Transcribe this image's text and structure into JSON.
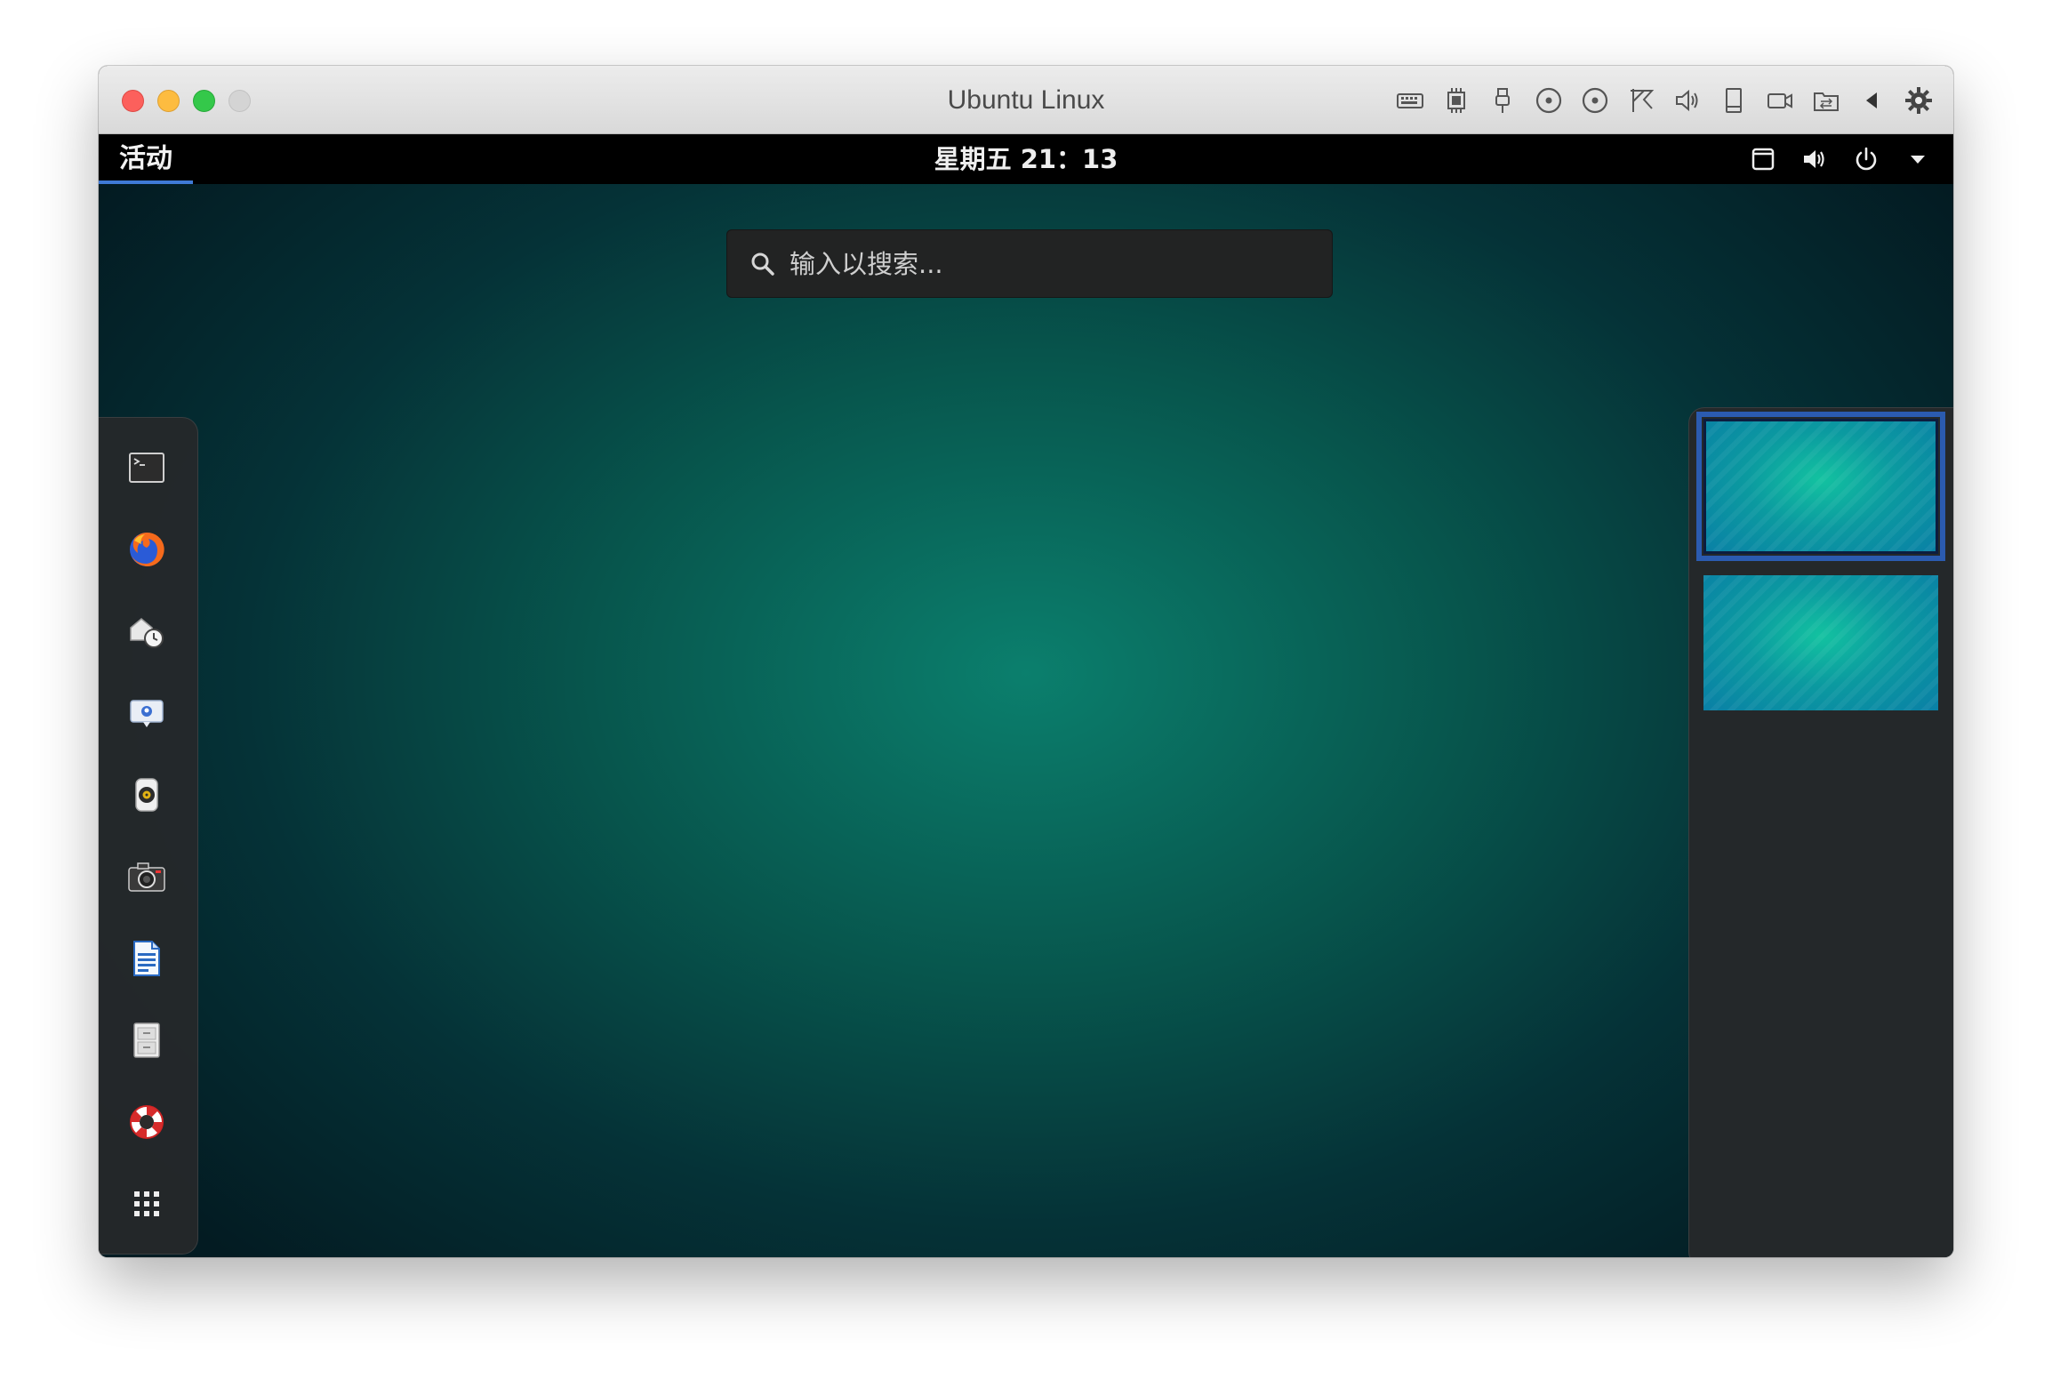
{
  "window": {
    "title": "Ubuntu Linux",
    "toolbar_icons": [
      "keyboard-icon",
      "cpu-icon",
      "usb-icon",
      "disc-icon",
      "disc-2-icon",
      "network-icon",
      "sound-icon",
      "storage-icon",
      "camera-icon",
      "shared-folder-icon",
      "back-arrow-icon",
      "settings-gear-icon"
    ]
  },
  "topbar": {
    "activities": "活动",
    "clock": "星期五 21：13",
    "status_icons": [
      "screen-icon",
      "volume-icon",
      "power-icon",
      "menu-arrow-icon"
    ]
  },
  "search": {
    "placeholder": "输入以搜索..."
  },
  "dash": {
    "apps": [
      {
        "name": "terminal-icon"
      },
      {
        "name": "firefox-icon"
      },
      {
        "name": "backups-icon"
      },
      {
        "name": "empathy-chat-icon"
      },
      {
        "name": "rhythmbox-icon"
      },
      {
        "name": "cheese-camera-icon"
      },
      {
        "name": "libreoffice-writer-icon"
      },
      {
        "name": "file-cabinet-icon"
      },
      {
        "name": "help-lifebuoy-icon"
      },
      {
        "name": "show-applications-icon"
      }
    ]
  },
  "workspaces": {
    "count": 2,
    "active_index": 0
  },
  "colors": {
    "activities_underline": "#3f7ad6",
    "workspace_active_border": "#2b5bb0",
    "background_center": "#0b7f6d"
  }
}
